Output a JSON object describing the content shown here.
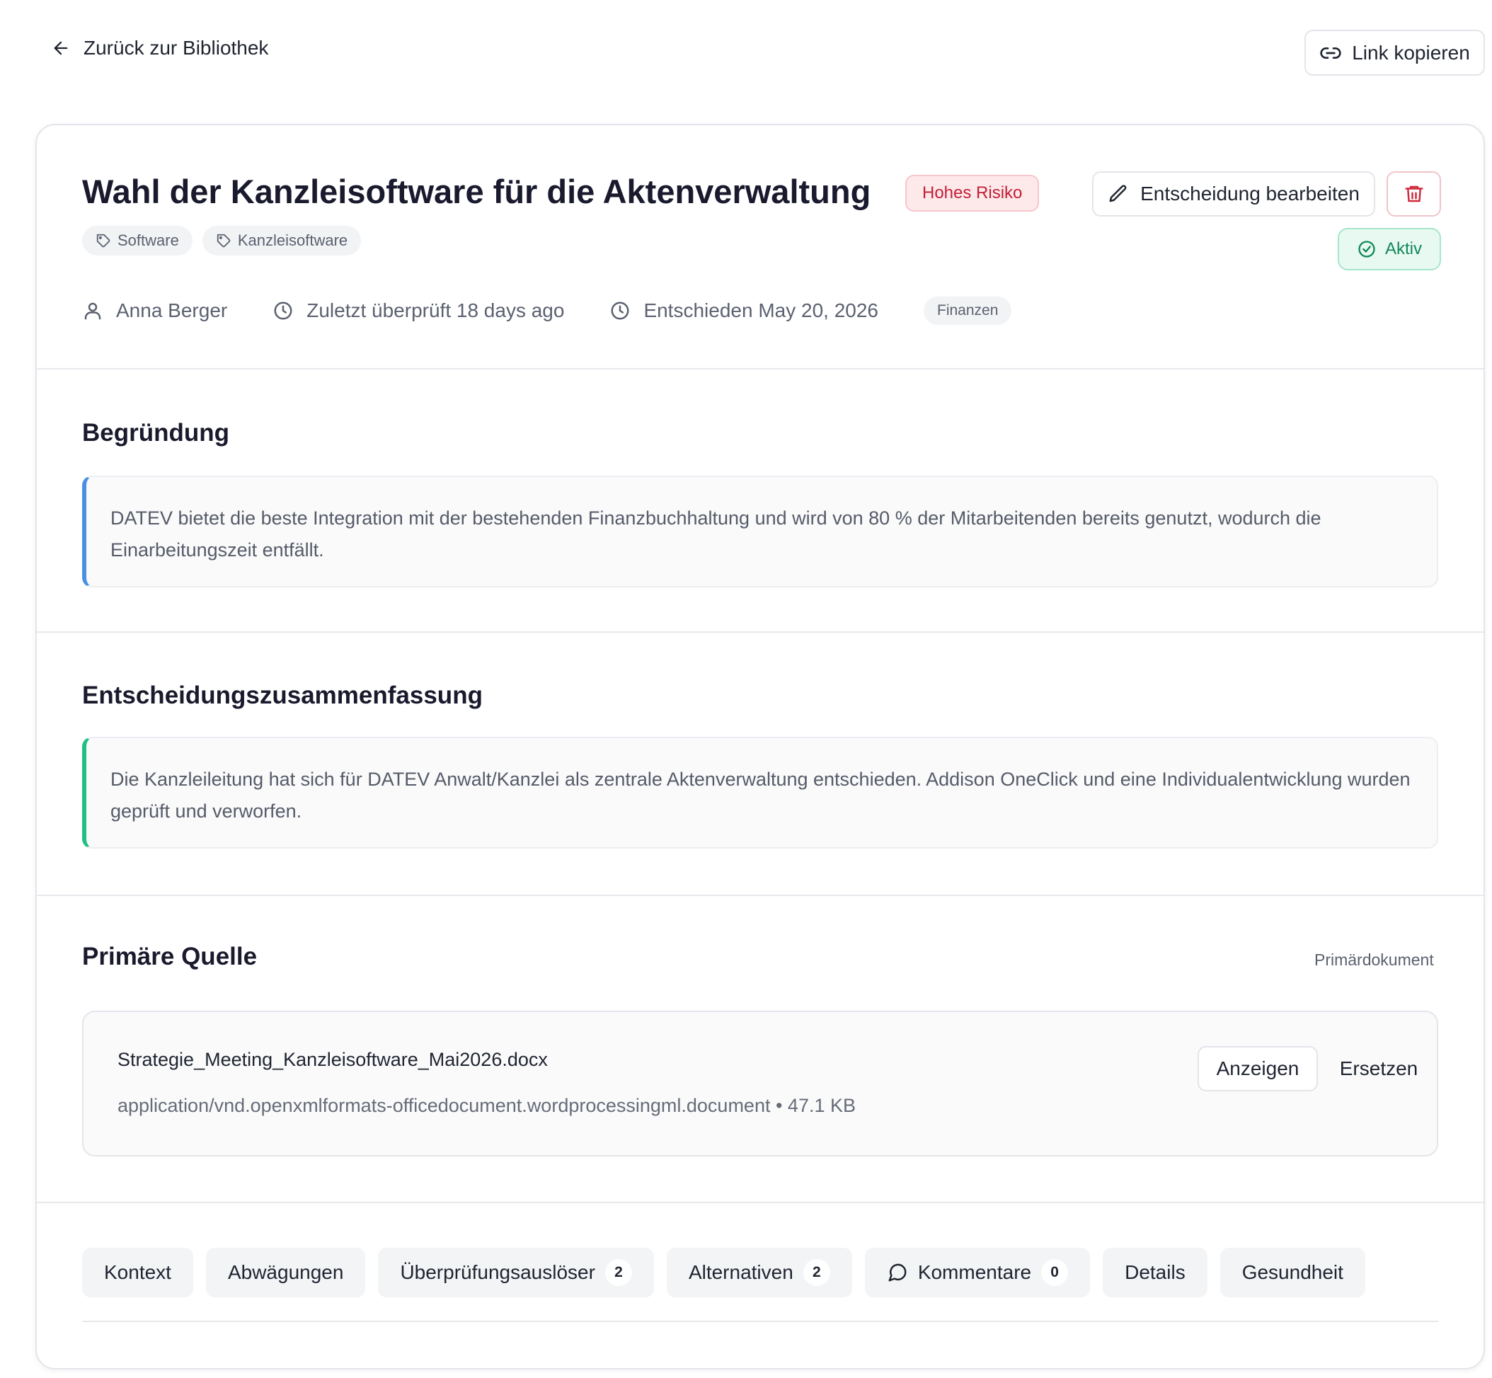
{
  "nav": {
    "back_label": "Zurück zur Bibliothek",
    "back_icon": "arrow-left-icon",
    "copy_link_label": "Link kopieren",
    "copy_link_icon": "link-icon"
  },
  "decision": {
    "title": "Wahl der Kanzleisoftware für die Aktenverwaltung",
    "risk_label": "Hohes Risiko",
    "edit_label": "Entscheidung bearbeiten",
    "status_label": "Aktiv",
    "tags": [
      "Software",
      "Kanzleisoftware"
    ],
    "owner": "Anna Berger",
    "last_reviewed": "Zuletzt überprüft 18 days ago",
    "decided": "Entschieden May 20, 2026",
    "department": "Finanzen"
  },
  "reasoning": {
    "heading": "Begründung",
    "text": "DATEV bietet die beste Integration mit der bestehenden Finanzbuchhaltung und wird von 80 % der Mitarbeitenden bereits genutzt, wodurch die Einarbeitungszeit entfällt."
  },
  "summary": {
    "heading": "Entscheidungszusammenfassung",
    "text": "Die Kanzleileitung hat sich für DATEV Anwalt/Kanzlei als zentrale Aktenverwaltung entschieden. Addison OneClick und eine Individualentwicklung wurden geprüft und verworfen."
  },
  "source": {
    "heading": "Primäre Quelle",
    "label": "Primärdokument",
    "file_name": "Strategie_Meeting_Kanzleisoftware_Mai2026.docx",
    "file_meta": "application/vnd.openxmlformats-officedocument.wordprocessingml.document • 47.1 KB",
    "view_label": "Anzeigen",
    "replace_label": "Ersetzen"
  },
  "tabs": [
    {
      "label": "Kontext"
    },
    {
      "label": "Abwägungen"
    },
    {
      "label": "Überprüfungsauslöser",
      "count": "2"
    },
    {
      "label": "Alternativen",
      "count": "2"
    },
    {
      "label": "Kommentare",
      "count": "0",
      "icon": "comment-icon"
    },
    {
      "label": "Details"
    },
    {
      "label": "Gesundheit"
    }
  ],
  "colors": {
    "risk": "#c21f35",
    "status": "#11875b",
    "reasoning_accent": "#4a90e2",
    "summary_accent": "#1fc081"
  }
}
